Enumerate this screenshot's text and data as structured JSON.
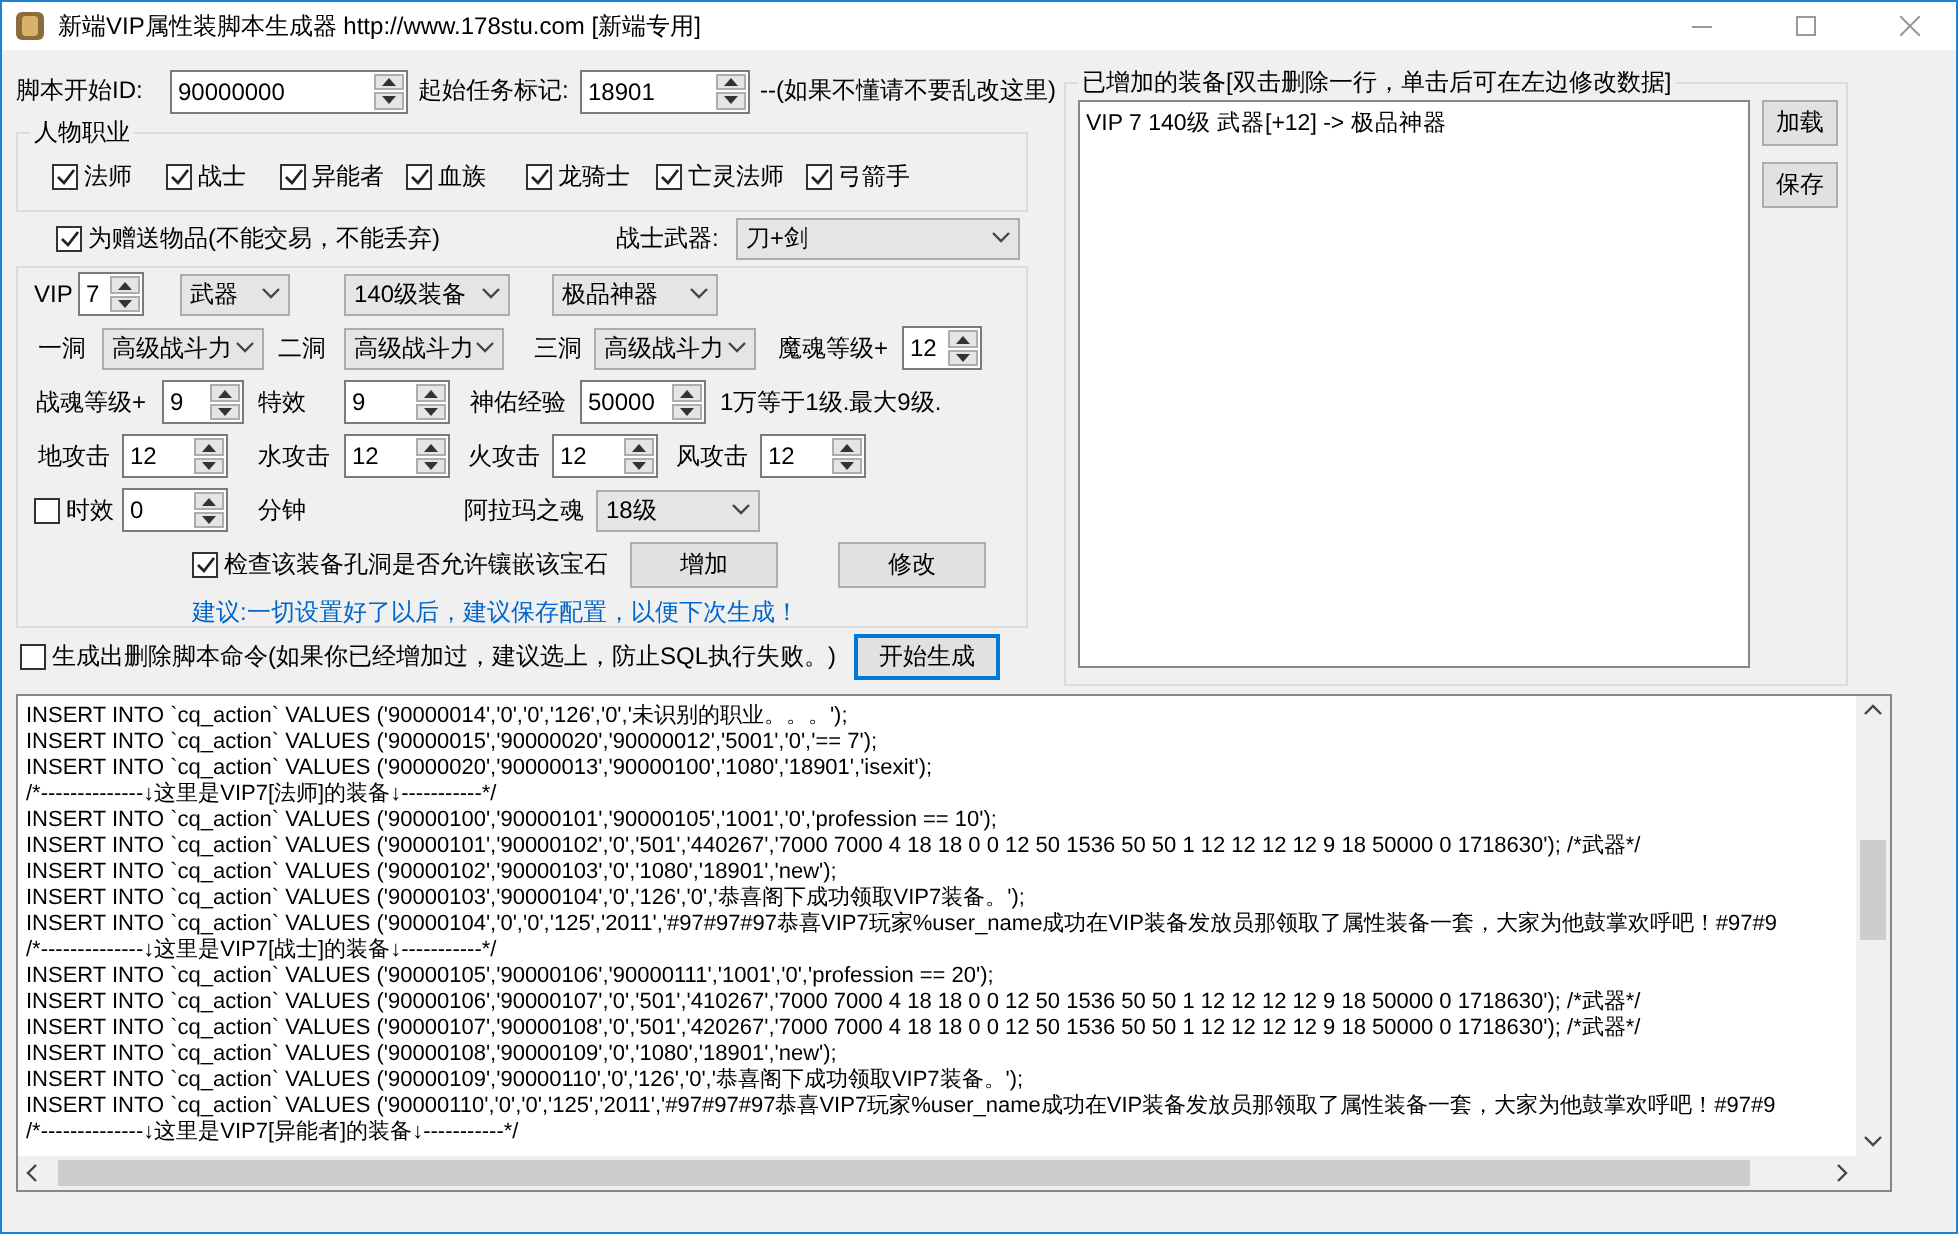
{
  "window": {
    "title": "新端VIP属性装脚本生成器 http://www.178stu.com [新端专用]"
  },
  "header": [
    {
      "kind": "label",
      "text": "脚本开始ID:"
    },
    {
      "kind": "spin",
      "value": "90000000"
    },
    {
      "kind": "label",
      "text": "起始任务标记:"
    },
    {
      "kind": "spin",
      "value": "18901"
    },
    {
      "kind": "label",
      "text": "--(如果不懂请不要乱改这里)"
    }
  ],
  "classes": {
    "title": "人物职业",
    "items": [
      {
        "label": "法师",
        "checked": true
      },
      {
        "label": "战士",
        "checked": true
      },
      {
        "label": "异能者",
        "checked": true
      },
      {
        "label": "血族",
        "checked": true
      },
      {
        "label": "龙骑士",
        "checked": true
      },
      {
        "label": "亡灵法师",
        "checked": true
      },
      {
        "label": "弓箭手",
        "checked": true
      }
    ]
  },
  "gift": {
    "label": "为赠送物品(不能交易，不能丢弃)",
    "checked": true
  },
  "weapon": {
    "label": "战士武器:",
    "value": "刀+剑"
  },
  "rows": [
    [
      {
        "kind": "label",
        "text": "VIP"
      },
      {
        "kind": "spin",
        "value": "7"
      },
      {
        "kind": "select",
        "value": "武器"
      },
      {
        "kind": "select",
        "value": "140级装备"
      },
      {
        "kind": "select",
        "value": "极品神器"
      }
    ],
    [
      {
        "kind": "label",
        "text": "一洞"
      },
      {
        "kind": "select",
        "value": "高级战斗力"
      },
      {
        "kind": "label",
        "text": "二洞"
      },
      {
        "kind": "select",
        "value": "高级战斗力"
      },
      {
        "kind": "label",
        "text": "三洞"
      },
      {
        "kind": "select",
        "value": "高级战斗力"
      },
      {
        "kind": "label",
        "text": "魔魂等级+"
      },
      {
        "kind": "spin",
        "value": "12"
      }
    ],
    [
      {
        "kind": "label",
        "text": "战魂等级+"
      },
      {
        "kind": "spin",
        "value": "9"
      },
      {
        "kind": "label",
        "text": "特效"
      },
      {
        "kind": "spin",
        "value": "9"
      },
      {
        "kind": "label",
        "text": "神佑经验"
      },
      {
        "kind": "spin",
        "value": "50000"
      },
      {
        "kind": "label",
        "text": "1万等于1级.最大9级."
      }
    ],
    [
      {
        "kind": "label",
        "text": "地攻击"
      },
      {
        "kind": "spin",
        "value": "12"
      },
      {
        "kind": "label",
        "text": "水攻击"
      },
      {
        "kind": "spin",
        "value": "12"
      },
      {
        "kind": "label",
        "text": "火攻击"
      },
      {
        "kind": "spin",
        "value": "12"
      },
      {
        "kind": "label",
        "text": "风攻击"
      },
      {
        "kind": "spin",
        "value": "12"
      }
    ],
    [
      {
        "kind": "checkbox",
        "text": "时效",
        "checked": false
      },
      {
        "kind": "spin",
        "value": "0"
      },
      {
        "kind": "label",
        "text": "分钟"
      },
      {
        "kind": "label",
        "text": "阿拉玛之魂"
      },
      {
        "kind": "select",
        "value": "18级"
      }
    ],
    [
      {
        "kind": "checkbox",
        "text": "检查该装备孔洞是否允许镶嵌该宝石",
        "checked": true
      },
      {
        "kind": "button",
        "text": "增加"
      },
      {
        "kind": "button",
        "text": "修改"
      }
    ],
    [
      {
        "kind": "hint",
        "text": "建议:一切设置好了以后，建议保存配置，以便下次生成！"
      }
    ]
  ],
  "delete_option": {
    "label": "生成出删除脚本命令(如果你已经增加过，建议选上，防止SQL执行失败。)",
    "checked": false
  },
  "generate_button": "开始生成",
  "added": {
    "title": "已增加的装备[双击删除一行，单击后可在左边修改数据]",
    "items": [
      "VIP 7 140级 武器[+12] -> 极品神器"
    ],
    "buttons": [
      "加载",
      "保存"
    ]
  },
  "log": [
    "INSERT INTO `cq_action` VALUES ('90000014','0','0','126','0','未识别的职业。。。');",
    "INSERT INTO `cq_action` VALUES ('90000015','90000020','90000012','5001','0','== 7');",
    "INSERT INTO `cq_action` VALUES ('90000020','90000013','90000100','1080','18901','isexit');",
    "/*--------------↓这里是VIP7[法师]的装备↓-----------*/",
    "INSERT INTO `cq_action` VALUES ('90000100','90000101','90000105','1001','0','profession == 10');",
    "INSERT INTO `cq_action` VALUES ('90000101','90000102','0','501','440267','7000 7000 4 18 18 0 0 12 50 1536 50 50 1 12 12 12 12 9 18 50000 0 1718630'); /*武器*/",
    "INSERT INTO `cq_action` VALUES ('90000102','90000103','0','1080','18901','new');",
    "INSERT INTO `cq_action` VALUES ('90000103','90000104','0','126','0','恭喜阁下成功领取VIP7装备。');",
    "INSERT INTO `cq_action` VALUES ('90000104','0','0','125','2011','#97#97#97恭喜VIP7玩家%user_name成功在VIP装备发放员那领取了属性装备一套，大家为他鼓掌欢呼吧！#97#9",
    "/*--------------↓这里是VIP7[战士]的装备↓-----------*/",
    "INSERT INTO `cq_action` VALUES ('90000105','90000106','90000111','1001','0','profession == 20');",
    "INSERT INTO `cq_action` VALUES ('90000106','90000107','0','501','410267','7000 7000 4 18 18 0 0 12 50 1536 50 50 1 12 12 12 12 9 18 50000 0 1718630'); /*武器*/",
    "INSERT INTO `cq_action` VALUES ('90000107','90000108','0','501','420267','7000 7000 4 18 18 0 0 12 50 1536 50 50 1 12 12 12 12 9 18 50000 0 1718630'); /*武器*/",
    "INSERT INTO `cq_action` VALUES ('90000108','90000109','0','1080','18901','new');",
    "INSERT INTO `cq_action` VALUES ('90000109','90000110','0','126','0','恭喜阁下成功领取VIP7装备。');",
    "INSERT INTO `cq_action` VALUES ('90000110','0','0','125','2011','#97#97#97恭喜VIP7玩家%user_name成功在VIP装备发放员那领取了属性装备一套，大家为他鼓掌欢呼吧！#97#9",
    "/*--------------↓这里是VIP7[异能者]的装备↓-----------*/"
  ]
}
